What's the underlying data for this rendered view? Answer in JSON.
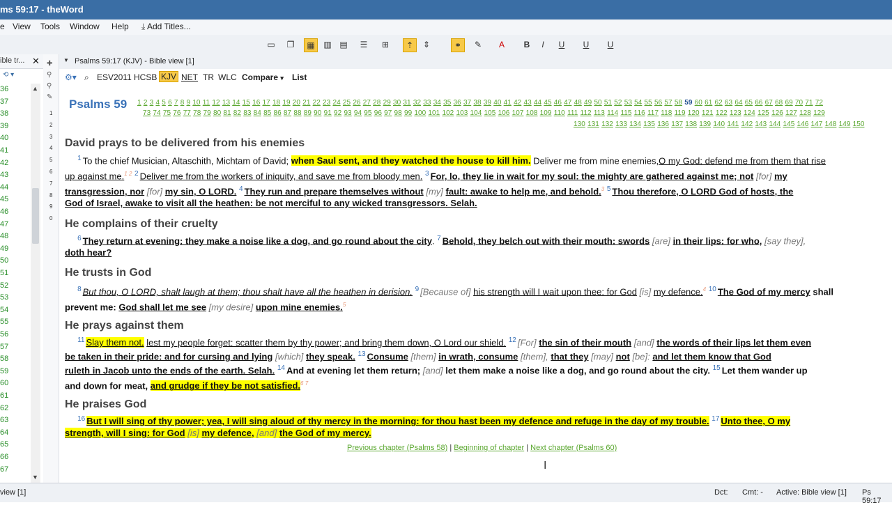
{
  "window": {
    "title": "ms 59:17 - theWord"
  },
  "menu": {
    "view": "View",
    "tools": "Tools",
    "window": "Window",
    "help": "Help",
    "add_titles": "Add Titles..."
  },
  "sidebar": {
    "title": "ible tr...",
    "numbers": [
      "36",
      "37",
      "38",
      "39",
      "40",
      "41",
      "42",
      "43",
      "44",
      "45",
      "46",
      "47",
      "48",
      "49",
      "50",
      "51",
      "52",
      "53",
      "54",
      "55",
      "56",
      "57",
      "58",
      "59",
      "60",
      "61",
      "62",
      "63",
      "64",
      "65",
      "66",
      "67"
    ]
  },
  "gutter": {
    "numbers": [
      "1",
      "2",
      "3",
      "4",
      "5",
      "6",
      "7",
      "8",
      "9",
      "0"
    ]
  },
  "view_header": {
    "title": "Psalms 59:17 (KJV) - Bible view [1]"
  },
  "versions": {
    "v1": "ESV2011",
    "v2": "HCSB",
    "v3": "KJV",
    "v4": "NET",
    "v5": "TR",
    "v6": "WLC",
    "compare": "Compare",
    "list": "List"
  },
  "chapter": {
    "title": "Psalms 59",
    "current": "59",
    "row1": [
      "1",
      "2",
      "3",
      "4",
      "5",
      "6",
      "7",
      "8",
      "9",
      "10",
      "11",
      "12",
      "13",
      "14",
      "15",
      "16",
      "17",
      "18",
      "19",
      "20",
      "21",
      "22",
      "23",
      "24",
      "25",
      "26",
      "27",
      "28",
      "29",
      "30",
      "31",
      "32",
      "33",
      "34",
      "35",
      "36",
      "37",
      "38",
      "39",
      "40",
      "41",
      "42",
      "43",
      "44",
      "45",
      "46",
      "47",
      "48",
      "49",
      "50",
      "51",
      "52",
      "53",
      "54",
      "55",
      "56",
      "57",
      "58",
      "59",
      "60",
      "61",
      "62",
      "63",
      "64",
      "65",
      "66",
      "67",
      "68",
      "69",
      "70",
      "71",
      "72"
    ],
    "row2": [
      "73",
      "74",
      "75",
      "76",
      "77",
      "78",
      "79",
      "80",
      "81",
      "82",
      "83",
      "84",
      "85",
      "86",
      "87",
      "88",
      "89",
      "90",
      "91",
      "92",
      "93",
      "94",
      "95",
      "96",
      "97",
      "98",
      "99",
      "100",
      "101",
      "102",
      "103",
      "104",
      "105",
      "106",
      "107",
      "108",
      "109",
      "110",
      "111",
      "112",
      "113",
      "114",
      "115",
      "116",
      "117",
      "118",
      "119",
      "120",
      "121",
      "122",
      "123",
      "124",
      "125",
      "126",
      "127",
      "128",
      "129"
    ],
    "row3": [
      "130",
      "131",
      "132",
      "133",
      "134",
      "135",
      "136",
      "137",
      "138",
      "139",
      "140",
      "141",
      "142",
      "143",
      "144",
      "145",
      "146",
      "147",
      "148",
      "149",
      "150"
    ]
  },
  "text": {
    "h1": "David prays to be delivered from his enemies",
    "l1a": "1",
    "l1b": "To the chief Musician, Altaschith, Michtam of David;",
    "l1c": "when Saul sent, and they watched the house to kill him.",
    "l1d": "Deliver me from mine enemies,",
    "l1e": "O my God: defend me from them that rise",
    "l2a": "up against me.",
    "l2fn": "1 2",
    "l2b": "2",
    "l2c": "Deliver me from the workers of iniquity, and save me from bloody men.",
    "l2d": "3",
    "l2e": "For, lo, they lie in wait for my soul: the mighty are gathered against me; not",
    "l2f": "[for]",
    "l2g": "my",
    "l3a": "transgression, nor",
    "l3b": "[for]",
    "l3c": "my sin, O LORD.",
    "l3d": "4",
    "l3e": "They run and prepare themselves without",
    "l3f": "[my]",
    "l3g": "fault: awake to help me, and behold.",
    "l3fn": "3",
    "l3h": "5",
    "l3i": "Thou therefore, O LORD God of hosts, the",
    "l4": "God of Israel, awake to visit all the heathen: be not merciful to any wicked transgressors. Selah.",
    "h2": "He complains of their cruelty",
    "l5a": "6",
    "l5b": "They return at evening: they make a noise like a dog, and go round about the city",
    "l5c": "7",
    "l5d": "Behold, they belch out with their mouth: swords",
    "l5e": "[are]",
    "l5f": "in their lips: for who,",
    "l5g": "[say they],",
    "l6": "doth hear?",
    "h3": "He trusts in God",
    "l7a": "8",
    "l7b": "But thou, O LORD, shalt laugh at them; thou shalt have all the heathen in derision.",
    "l7c": "9",
    "l7d": "[Because of]",
    "l7e": "his strength will I wait upon thee: for God",
    "l7f": "[is]",
    "l7g": "my defence.",
    "l7fn": "4",
    "l7h": "10",
    "l7i": "The God of my mercy",
    "l7j": "shall",
    "l8a": "prevent me:",
    "l8b": "God shall let me see",
    "l8c": "[my desire]",
    "l8d": "upon mine enemies.",
    "l8fn": "5",
    "h4": "He prays against them",
    "l9a": "11",
    "l9b": "Slay them not,",
    "l9c": "lest my people forget: scatter them by thy power; and bring them down, O Lord our shield.",
    "l9d": "12",
    "l9e": "[For]",
    "l9f": "the sin of their mouth",
    "l9g": "[and]",
    "l9h": "the words of their lips let them even",
    "l10a": "be taken in their pride: and for cursing and lying",
    "l10b": "[which]",
    "l10c": "they speak.",
    "l10d": "13",
    "l10e": "Consume",
    "l10f": "[them]",
    "l10g": "in wrath, consume",
    "l10h": "[them],",
    "l10i": "that they",
    "l10j": "[may]",
    "l10k": "not",
    "l10l": "[be]:",
    "l10m": "and let them know that God",
    "l11a": "ruleth in Jacob unto the ends of the earth. Selah.",
    "l11b": "14",
    "l11c": "And at evening let them return;",
    "l11d": "[and]",
    "l11e": "let them make a noise like a dog, and go round about the city.",
    "l11f": "15",
    "l11g": "Let them wander up",
    "l12a": "and down for meat,",
    "l12b": "and grudge if they be not satisfied.",
    "l12fn": "6 7",
    "h5": "He praises God",
    "l13a": "16",
    "l13b": "But I will sing of thy power; yea, I will sing aloud of thy mercy in the morning: for thou hast been my defence and refuge in the day of my trouble.",
    "l13c": "17",
    "l13d": "Unto thee, O my",
    "l14a": "strength, will I sing: for God",
    "l14b": "[is]",
    "l14c": "my defence,",
    "l14d": "[and]",
    "l14e": "the God of my mercy."
  },
  "chapnav": {
    "prev": "Previous chapter (Psalms 58)",
    "begin": "Beginning of chapter",
    "next": "Next chapter (Psalms 60)",
    "sep": "|"
  },
  "status": {
    "left": "view [1]",
    "dct": "Dct:",
    "cmt": "Cmt: -",
    "active": "Active: Bible view [1]",
    "ref": "Ps 59:17"
  },
  "colors": {
    "highlight": "#ffff00",
    "link_green": "#5aa72f",
    "accent_blue": "#3a72b8",
    "titlebar": "#3a6ea5"
  }
}
